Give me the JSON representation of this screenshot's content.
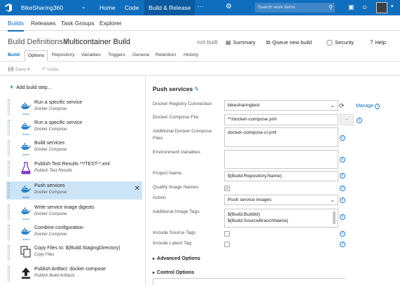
{
  "topbar": {
    "project": "BikeSharing360",
    "nav": [
      "Home",
      "Code",
      "Build & Release"
    ],
    "more": "···",
    "search_placeholder": "Search work items",
    "colors": {
      "bar": "#106ebe",
      "active": "#0b5aa0"
    }
  },
  "subnav": {
    "items": [
      "Builds",
      "Releases",
      "Task Groups",
      "Explorer"
    ]
  },
  "title": {
    "crumb": "Build Definitions /",
    "name": "Multicontainer Build",
    "state": "not built",
    "actions": {
      "summary": "Summary",
      "queue": "Queue new build",
      "security": "Security",
      "help": "Help"
    }
  },
  "tabs": [
    "Build",
    "Options",
    "Repository",
    "Variables",
    "Triggers",
    "General",
    "Retention",
    "History"
  ],
  "toolbar": {
    "save": "Save",
    "undo": "Undo"
  },
  "left": {
    "add_step": "Add build step...",
    "steps": [
      {
        "name": "Run a specific service",
        "sub": "Docker Compose",
        "icon": "docker-icon"
      },
      {
        "name": "Run a specific service",
        "sub": "Docker Compose",
        "icon": "docker-icon"
      },
      {
        "name": "Build services",
        "sub": "Docker Compose",
        "icon": "docker-icon"
      },
      {
        "name": "Publish Test Results **/TEST-*.xml",
        "sub": "Publish Test Results",
        "icon": "flask-icon"
      },
      {
        "name": "Push services",
        "sub": "Docker Compose",
        "icon": "docker-icon"
      },
      {
        "name": "Write service image digests",
        "sub": "Docker Compose",
        "icon": "docker-icon"
      },
      {
        "name": "Combine configuration",
        "sub": "Docker Compose",
        "icon": "docker-icon"
      },
      {
        "name": "Copy Files to: $(Build.StagingDirectory)",
        "sub": "Copy Files",
        "icon": "copy-files-icon"
      },
      {
        "name": "Publish Artifact: docker-compose",
        "sub": "Publish Build Artifacts",
        "icon": "upload-icon"
      }
    ],
    "docker_word": "docker"
  },
  "right": {
    "title": "Push services",
    "labels": {
      "registry": "Docker Registry Connection",
      "compose_file": "Docker Compose File",
      "additional_files": "Additional Docker Compose Files",
      "env_vars": "Environment Variables",
      "project_name": "Project Name",
      "qualify": "Qualify Image Names",
      "action": "Action",
      "additional_tags": "Additional Image Tags",
      "source_tags": "Include Source Tags",
      "latest_tag": "Include Latest Tag"
    },
    "values": {
      "registry": "bikesharingtest",
      "compose_file": "**/docker-compose.yml",
      "additional_files": "docker-compose.ci.yml",
      "env_vars": "",
      "project_name": "$(Build.Repository.Name)",
      "action": "Push service images",
      "tag1": "$(Build.BuildId)",
      "tag2": "$(Build.SourceBranchName)"
    },
    "qualify_checked": true,
    "source_tags_checked": false,
    "latest_tag_checked": false,
    "manage": "Manage",
    "ellipsis": "...",
    "advanced": "Advanced Options",
    "control": "Control Options"
  }
}
